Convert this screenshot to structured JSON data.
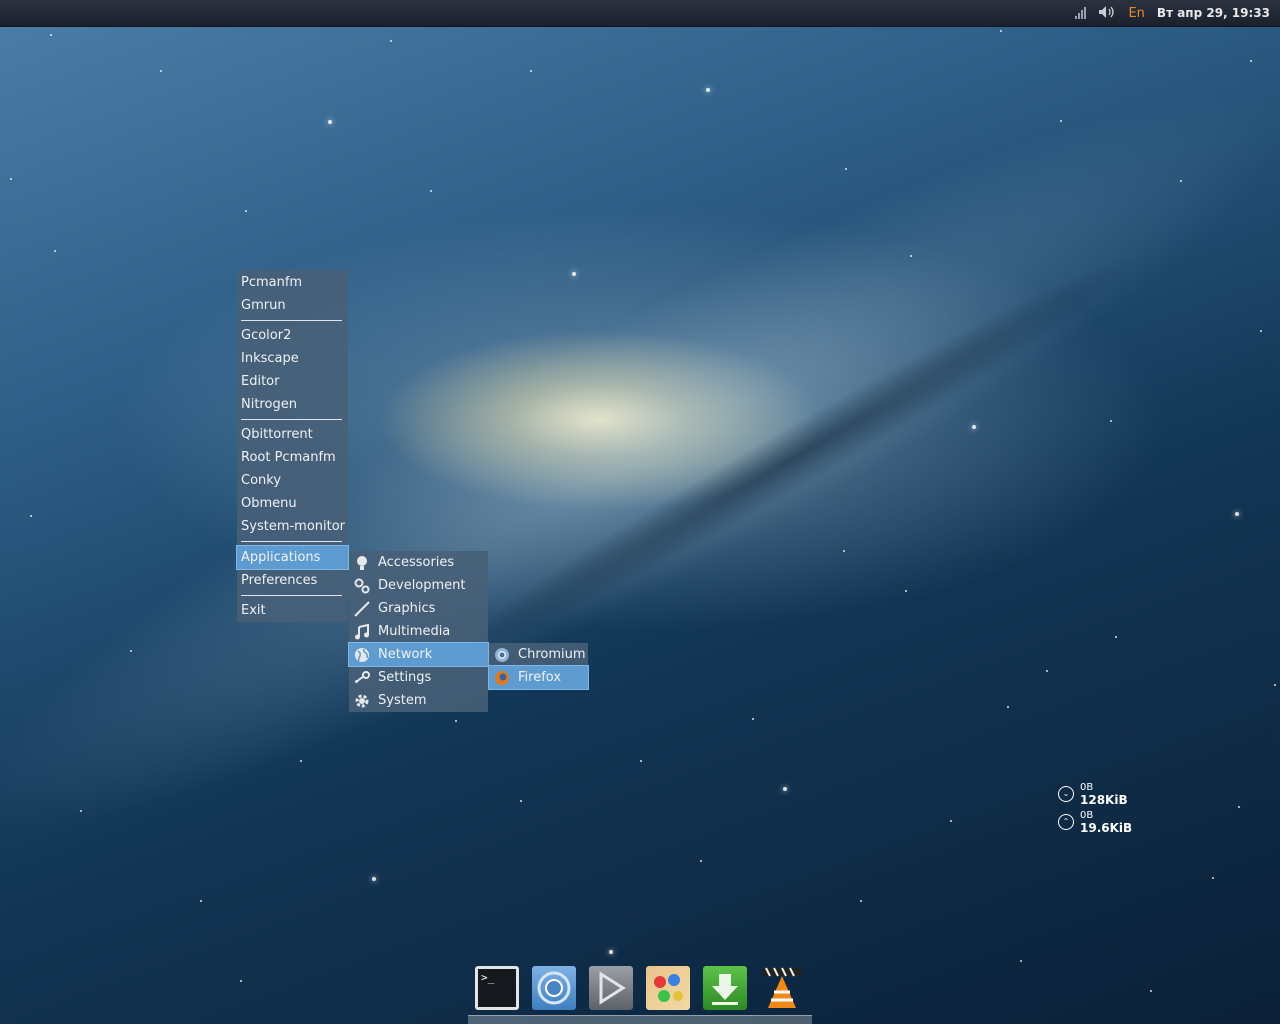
{
  "panel": {
    "language": "En",
    "clock": "Вт апр 29, 19:33"
  },
  "main_menu": {
    "groups": [
      [
        "Pcmanfm",
        "Gmrun"
      ],
      [
        "Gcolor2",
        "Inkscape",
        "Editor",
        "Nitrogen"
      ],
      [
        "Qbittorrent",
        "Root Pcmanfm",
        "Conky",
        "Obmenu",
        "System-monitor"
      ],
      [
        "Applications",
        "Preferences"
      ],
      [
        "Exit"
      ]
    ],
    "selected": "Applications"
  },
  "applications_menu": {
    "items": [
      {
        "label": "Accessories",
        "icon": "lightbulb-icon"
      },
      {
        "label": "Development",
        "icon": "gears-icon"
      },
      {
        "label": "Graphics",
        "icon": "brush-icon"
      },
      {
        "label": "Multimedia",
        "icon": "music-note-icon"
      },
      {
        "label": "Network",
        "icon": "globe-icon"
      },
      {
        "label": "Settings",
        "icon": "wrench-icon"
      },
      {
        "label": "System",
        "icon": "gear-icon"
      }
    ],
    "selected": "Network"
  },
  "network_menu": {
    "items": [
      {
        "label": "Chromium",
        "icon": "chromium-icon"
      },
      {
        "label": "Firefox",
        "icon": "firefox-icon"
      }
    ],
    "selected": "Firefox"
  },
  "conky": {
    "download_small": "0B",
    "download_total": "128KiB",
    "upload_small": "0B",
    "upload_total": "19.6KiB"
  },
  "dock": {
    "items": [
      {
        "name": "terminal-icon"
      },
      {
        "name": "chromium-icon"
      },
      {
        "name": "media-player-icon"
      },
      {
        "name": "paint-icon"
      },
      {
        "name": "download-manager-icon"
      },
      {
        "name": "vlc-icon"
      }
    ]
  },
  "colors": {
    "menu_bg": "#486078",
    "selection": "#5d9bd1",
    "language_accent": "#e98a2a"
  }
}
